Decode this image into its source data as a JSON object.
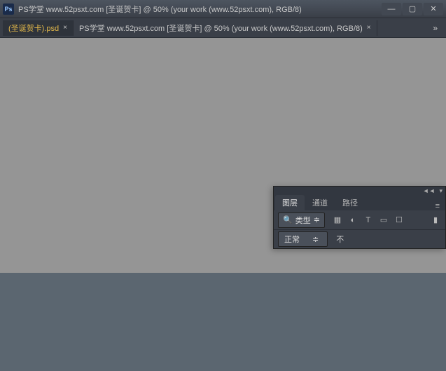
{
  "app_icon_text": "Ps",
  "window_title": "PS学堂 www.52psxt.com [圣诞贺卡] @ 50% (your work (www.52psxt.com), RGB/8)",
  "win_controls": {
    "minimize": "—",
    "maximize": "▢",
    "close": "✕"
  },
  "tabs": [
    {
      "label": "(圣诞贺卡).psd",
      "close": "×"
    },
    {
      "label": "PS学堂 www.52psxt.com [圣诞贺卡] @ 50% (your work (www.52psxt.com), RGB/8)",
      "close": "×"
    }
  ],
  "tab_overflow": "»",
  "panel": {
    "collapse_l": "◄◄",
    "collapse_r": "▾",
    "tabs": [
      "图层",
      "通道",
      "路径"
    ],
    "menu": "≡",
    "filter": {
      "search_icon": "🔍",
      "kind_label": "类型",
      "chevron": "≑",
      "icons": {
        "pixel": "▦",
        "adjust": "◐",
        "type": "T",
        "shape": "▭",
        "smart": "☐"
      },
      "toggle": "▮"
    },
    "blend": {
      "mode": "正常",
      "chevron": "≑",
      "opacity_label": "不"
    }
  }
}
